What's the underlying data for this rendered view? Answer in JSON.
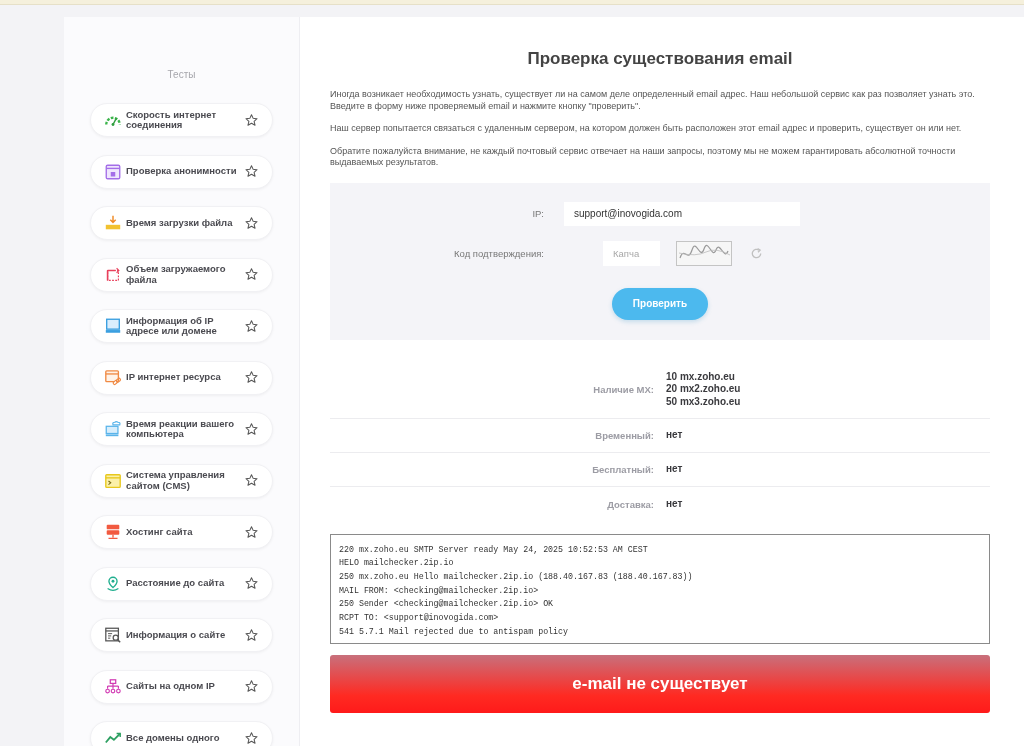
{
  "sidebar": {
    "title": "Тесты",
    "items": [
      {
        "label": "Скорость интернет соединения",
        "starred": false
      },
      {
        "label": "Проверка анонимности",
        "starred": false
      },
      {
        "label": "Время загрузки файла",
        "starred": false
      },
      {
        "label": "Объем загружаемого файла",
        "starred": false
      },
      {
        "label": "Информация об IP адресе или домене",
        "starred": false
      },
      {
        "label": "IP интернет ресурса",
        "starred": false
      },
      {
        "label": "Время реакции вашего компьютера",
        "starred": false
      },
      {
        "label": "Система управления сайтом (CMS)",
        "starred": false
      },
      {
        "label": "Хостинг сайта",
        "starred": false
      },
      {
        "label": "Расстояние до сайта",
        "starred": false
      },
      {
        "label": "Информация о сайте",
        "starred": false
      },
      {
        "label": "Сайты на одном IP",
        "starred": false
      },
      {
        "label": "Все домены одного",
        "starred": false
      }
    ]
  },
  "main": {
    "title": "Проверка существования email",
    "paragraphs": [
      "Иногда возникает необходимость узнать, существует ли на самом деле определенный email адрес. Наш небольшой сервис как раз позволяет узнать это. Введите в форму ниже проверяемый email и нажмите кнопку \"проверить\".",
      "Наш сервер попытается связаться с удаленным сервером, на котором должен быть расположен этот email адрес и проверить, существует он или нет.",
      "Обратите пожалуйста внимание, не каждый почтовый сервис отвечает на наши запросы, поэтому мы не можем гарантировать абсолютной точности выдаваемых результатов."
    ]
  },
  "form": {
    "email": {
      "label": "IP:",
      "value": "support@inovogida.com"
    },
    "captcha": {
      "label": "Код подтверждения:",
      "placeholder": "Капча"
    },
    "button": "Проверить"
  },
  "results": [
    {
      "label": "Наличие MX:",
      "values": [
        "**10** mx.zoho.eu",
        "**20** mx2.zoho.eu",
        "**50** mx3.zoho.eu"
      ]
    },
    {
      "label": "Временный:",
      "values": [
        "нет"
      ]
    },
    {
      "label": "Бесплатный:",
      "values": [
        "нет"
      ]
    },
    {
      "label": "Доставка:",
      "values": [
        "нет"
      ]
    }
  ],
  "log": [
    "220 mx.zoho.eu SMTP Server ready May 24, 2025 10:52:53 AM CEST",
    "HELO mailchecker.2ip.io",
    "250 mx.zoho.eu Hello mailchecker.2ip.io (188.40.167.83 (188.40.167.83))",
    "MAIL FROM: <checking@mailchecker.2ip.io>",
    "250 Sender <checking@mailchecker.2ip.io> OK",
    "RCPT TO: <support@inovogida.com>",
    "541 5.7.1 Mail rejected due to antispam policy"
  ],
  "verdict": {
    "text": "e-mail не существует",
    "kind": "error"
  }
}
